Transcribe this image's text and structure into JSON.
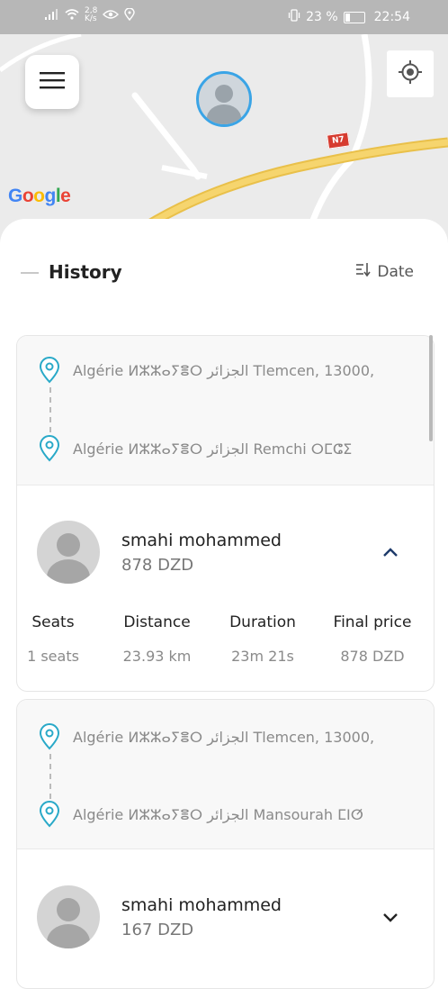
{
  "statusbar": {
    "net_speed": "2,8\nK/s",
    "battery_percent": "23 %",
    "time": "22:54"
  },
  "map": {
    "google_logo": "Google",
    "route_label": "N7",
    "colors": {
      "google_blue": "#4285F4",
      "google_red": "#EA4335",
      "google_yellow": "#FBBC05",
      "google_green": "#34A853",
      "road": "#f2c94c"
    }
  },
  "history": {
    "title": "History",
    "sort_label": "Date"
  },
  "trips": [
    {
      "from": "Algérie ⵍⵣⵣⴰⵢⴻⵔ الجزائر Tlemcen, 13000,",
      "to": "Algérie ⵍⵣⵣⴰⵢⴻⵔ الجزائر Remchi ⵔⵎⵛⵉ",
      "driver_name": "smahi mohammed",
      "price": "878 DZD",
      "expanded": true,
      "stats": [
        {
          "label": "Seats",
          "value": "1 seats"
        },
        {
          "label": "Distance",
          "value": "23.93 km"
        },
        {
          "label": "Duration",
          "value": "23m 21s"
        },
        {
          "label": "Final price",
          "value": "878 DZD"
        }
      ]
    },
    {
      "from": "Algérie ⵍⵣⵣⴰⵢⴻⵔ الجزائر Tlemcen, 13000,",
      "to": "Algérie ⵍⵣⵣⴰⵢⴻⵔ الجزائر Mansourah ⵎⵏⵚ",
      "driver_name": "smahi mohammed",
      "price": "167 DZD",
      "expanded": false
    }
  ]
}
